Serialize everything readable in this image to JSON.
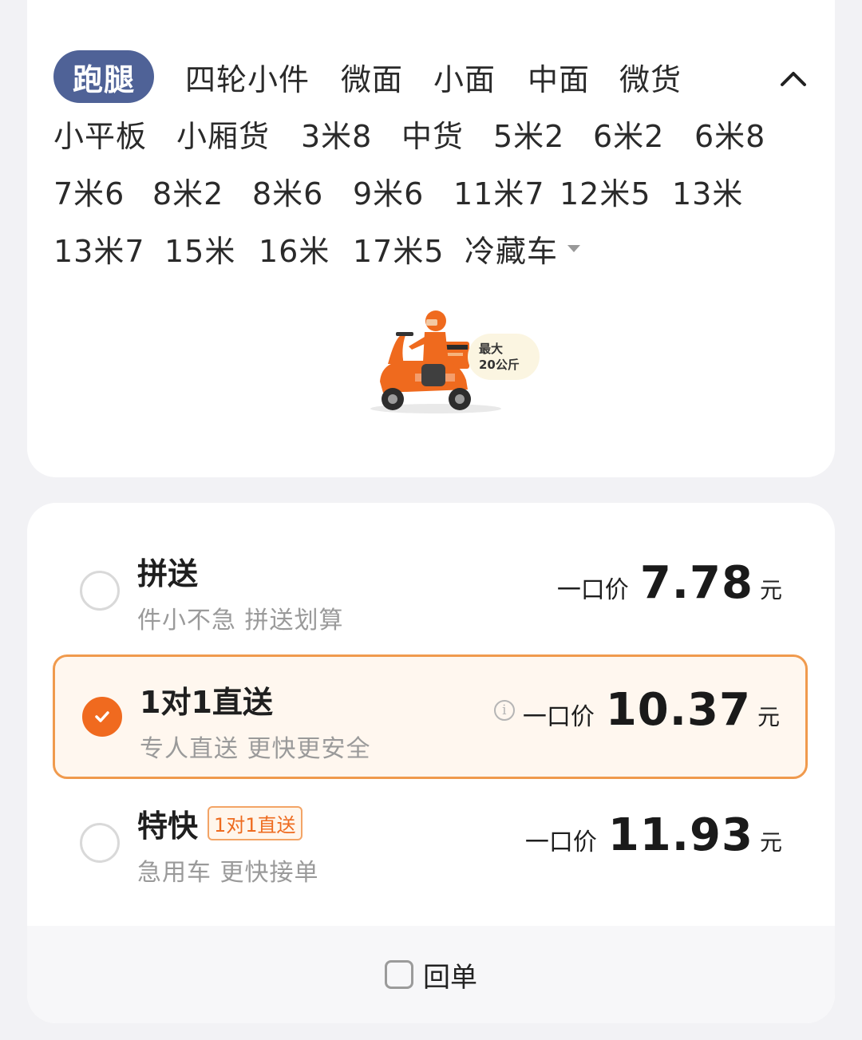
{
  "vehicle_types": {
    "row1": [
      "跑腿",
      "四轮小件",
      "微面",
      "小面",
      "中面",
      "微货"
    ],
    "row2": [
      "小平板",
      "小厢货",
      "3米8",
      "中货",
      "5米2",
      "6米2",
      "6米8"
    ],
    "row3": [
      "7米6",
      "8米2",
      "8米6",
      "9米6",
      "11米7",
      "12米5",
      "13米"
    ],
    "row4": [
      "13米7",
      "15米",
      "16米",
      "17米5",
      "冷藏车"
    ],
    "selected": "跑腿",
    "collapse_icon": "chevron-up-icon"
  },
  "capacity": {
    "line1": "最大",
    "line2": "20公斤"
  },
  "options": [
    {
      "title": "拼送",
      "subtitle": "件小不急 拼送划算",
      "price_label": "一口价",
      "price": "7.78",
      "unit": "元",
      "selected": false
    },
    {
      "title": "1对1直送",
      "subtitle": "专人直送 更快更安全",
      "price_label": "一口价",
      "price": "10.37",
      "unit": "元",
      "selected": true,
      "info_icon": "i"
    },
    {
      "title": "特快",
      "tag": "1对1直送",
      "subtitle": "急用车 更快接单",
      "price_label": "一口价",
      "price": "11.93",
      "unit": "元",
      "selected": false
    }
  ],
  "footer": {
    "return_label": "回单",
    "return_checked": false
  },
  "colors": {
    "accent": "#f06a1f",
    "selected_chip": "#4f6297",
    "selected_border": "#f09a4d"
  }
}
